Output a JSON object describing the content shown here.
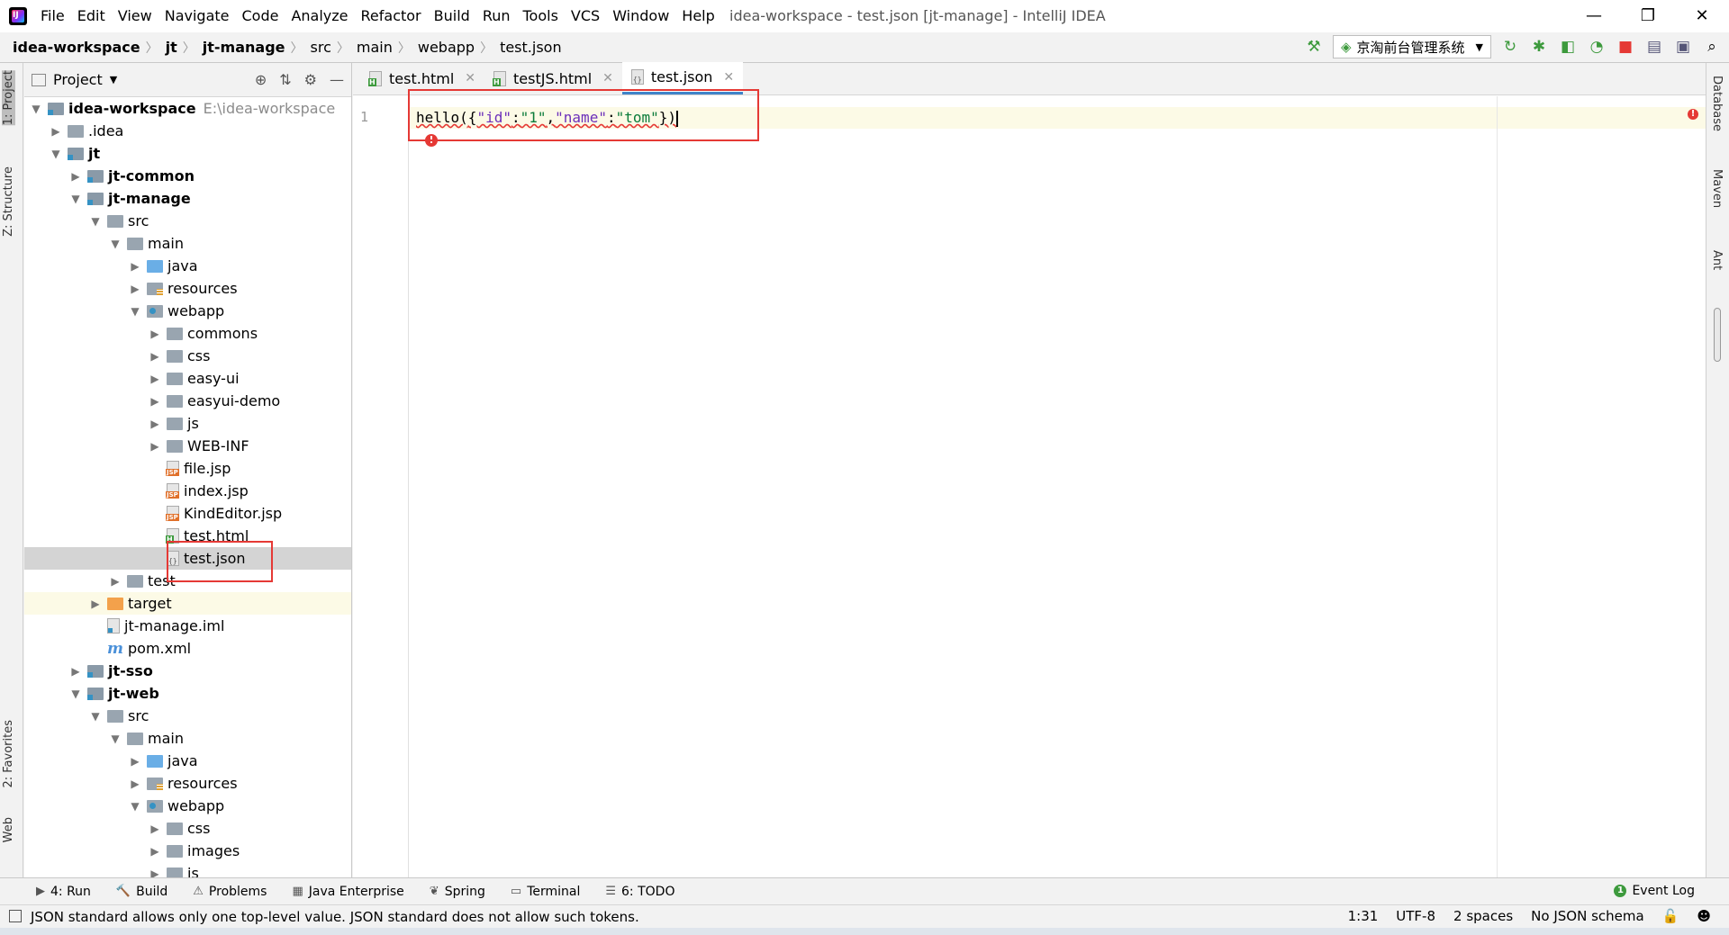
{
  "title_bar": {
    "menu": [
      "File",
      "Edit",
      "View",
      "Navigate",
      "Code",
      "Analyze",
      "Refactor",
      "Build",
      "Run",
      "Tools",
      "VCS",
      "Window",
      "Help"
    ],
    "window_title": "idea-workspace - test.json [jt-manage] - IntelliJ IDEA"
  },
  "breadcrumb": [
    "idea-workspace",
    "jt",
    "jt-manage",
    "src",
    "main",
    "webapp",
    "test.json"
  ],
  "run_config": "京淘前台管理系统",
  "left_tool_tabs": {
    "project": "1: Project",
    "structure": "Z: Structure",
    "favorites": "2: Favorites",
    "web": "Web"
  },
  "right_tool_tabs": {
    "database": "Database",
    "maven": "Maven",
    "ant": "Ant"
  },
  "project_panel": {
    "title": "Project",
    "tree": [
      {
        "label": "idea-workspace",
        "extra": "E:\\idea-workspace",
        "level": 0,
        "arrow": "open",
        "icon": "folder module",
        "bold": true
      },
      {
        "label": ".idea",
        "level": 1,
        "arrow": "closed",
        "icon": "folder"
      },
      {
        "label": "jt",
        "level": 1,
        "arrow": "open",
        "icon": "folder module",
        "bold": true
      },
      {
        "label": "jt-common",
        "level": 2,
        "arrow": "closed",
        "icon": "folder module",
        "bold": true
      },
      {
        "label": "jt-manage",
        "level": 2,
        "arrow": "open",
        "icon": "folder module",
        "bold": true
      },
      {
        "label": "src",
        "level": 3,
        "arrow": "open",
        "icon": "folder"
      },
      {
        "label": "main",
        "level": 4,
        "arrow": "open",
        "icon": "folder"
      },
      {
        "label": "java",
        "level": 5,
        "arrow": "closed",
        "icon": "folder blue"
      },
      {
        "label": "resources",
        "level": 5,
        "arrow": "closed",
        "icon": "folder res"
      },
      {
        "label": "webapp",
        "level": 5,
        "arrow": "open",
        "icon": "folder web"
      },
      {
        "label": "commons",
        "level": 6,
        "arrow": "closed",
        "icon": "folder"
      },
      {
        "label": "css",
        "level": 6,
        "arrow": "closed",
        "icon": "folder"
      },
      {
        "label": "easy-ui",
        "level": 6,
        "arrow": "closed",
        "icon": "folder"
      },
      {
        "label": "easyui-demo",
        "level": 6,
        "arrow": "closed",
        "icon": "folder"
      },
      {
        "label": "js",
        "level": 6,
        "arrow": "closed",
        "icon": "folder"
      },
      {
        "label": "WEB-INF",
        "level": 6,
        "arrow": "closed",
        "icon": "folder"
      },
      {
        "label": "file.jsp",
        "level": 6,
        "arrow": "none",
        "icon": "file jsp"
      },
      {
        "label": "index.jsp",
        "level": 6,
        "arrow": "none",
        "icon": "file jsp"
      },
      {
        "label": "KindEditor.jsp",
        "level": 6,
        "arrow": "none",
        "icon": "file jsp"
      },
      {
        "label": "test.html",
        "level": 6,
        "arrow": "none",
        "icon": "file html"
      },
      {
        "label": "test.json",
        "level": 6,
        "arrow": "none",
        "icon": "file json",
        "selected": true
      },
      {
        "label": "test",
        "level": 4,
        "arrow": "closed",
        "icon": "folder"
      },
      {
        "label": "target",
        "level": 3,
        "arrow": "closed",
        "icon": "folder orange",
        "excluded": true
      },
      {
        "label": "jt-manage.iml",
        "level": 3,
        "arrow": "none",
        "icon": "file iml"
      },
      {
        "label": "pom.xml",
        "level": 3,
        "arrow": "none",
        "icon": "maven"
      },
      {
        "label": "jt-sso",
        "level": 2,
        "arrow": "closed",
        "icon": "folder module",
        "bold": true
      },
      {
        "label": "jt-web",
        "level": 2,
        "arrow": "open",
        "icon": "folder module",
        "bold": true
      },
      {
        "label": "src",
        "level": 3,
        "arrow": "open",
        "icon": "folder"
      },
      {
        "label": "main",
        "level": 4,
        "arrow": "open",
        "icon": "folder"
      },
      {
        "label": "java",
        "level": 5,
        "arrow": "closed",
        "icon": "folder blue"
      },
      {
        "label": "resources",
        "level": 5,
        "arrow": "closed",
        "icon": "folder res"
      },
      {
        "label": "webapp",
        "level": 5,
        "arrow": "open",
        "icon": "folder web"
      },
      {
        "label": "css",
        "level": 6,
        "arrow": "closed",
        "icon": "folder"
      },
      {
        "label": "images",
        "level": 6,
        "arrow": "closed",
        "icon": "folder"
      },
      {
        "label": "js",
        "level": 6,
        "arrow": "closed",
        "icon": "folder"
      }
    ]
  },
  "editor": {
    "tabs": [
      {
        "label": "test.html",
        "icon": "file html",
        "active": false
      },
      {
        "label": "testJS.html",
        "icon": "file html",
        "active": false
      },
      {
        "label": "test.json",
        "icon": "file json",
        "active": true
      }
    ],
    "line_number": "1",
    "code_tokens": {
      "fn": "hello(",
      "brace_open": "{",
      "key1": "\"id\"",
      "colon1": ":",
      "val1": "\"1\"",
      "comma": ",",
      "key2": "\"name\"",
      "colon2": ":",
      "val2": "\"tom\"",
      "close": "})"
    }
  },
  "bottom_tools": [
    {
      "label": "4: Run",
      "icon": "▶"
    },
    {
      "label": "Build",
      "icon": "🔨"
    },
    {
      "label": "Problems",
      "icon": "⚠"
    },
    {
      "label": "Java Enterprise",
      "icon": "▦"
    },
    {
      "label": "Spring",
      "icon": "❦"
    },
    {
      "label": "Terminal",
      "icon": "▭"
    },
    {
      "label": "6: TODO",
      "icon": "☰"
    }
  ],
  "event_log": "Event Log",
  "status": {
    "message": "JSON standard allows only one top-level value. JSON standard does not allow such tokens.",
    "position": "1:31",
    "encoding": "UTF-8",
    "indent": "2 spaces",
    "schema": "No JSON schema"
  }
}
